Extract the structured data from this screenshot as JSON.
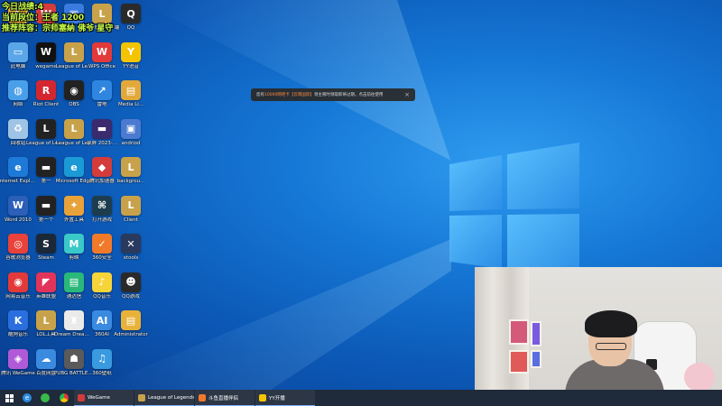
{
  "overlay": {
    "line1": "今日战绩:4",
    "line2": "当前段位：王者 1200",
    "line3": "推荐阵容：宗师塞納 佛爷 星守"
  },
  "notice": {
    "prefix": "您有",
    "highlight1": "10000网吧卡",
    "highlight2": "【云萌国际】",
    "suffix": "领主限时领取即将过期，点击前往使用",
    "close": "×"
  },
  "desktop_icons": [
    {
      "label": "",
      "color": "#e8b23a",
      "glyph": "L",
      "icon": "league-icon"
    },
    {
      "label": "",
      "color": "#d63b3b",
      "glyph": "W",
      "icon": "wegame-icon"
    },
    {
      "label": "",
      "color": "#3b7be0",
      "glyph": "▣",
      "icon": "app-icon"
    },
    {
      "label": "英雄联盟客户端",
      "color": "#c8a24a",
      "glyph": "L",
      "icon": "league-icon"
    },
    {
      "label": "QQ",
      "color": "#2a2a2a",
      "glyph": "Q",
      "icon": "qq-icon"
    },
    {
      "label": "此电脑",
      "color": "#5aa6e8",
      "glyph": "▭",
      "icon": "computer-icon"
    },
    {
      "label": "wegame",
      "color": "#111",
      "glyph": "W",
      "icon": "wegame-icon"
    },
    {
      "label": "League of Le...",
      "color": "#c8a24a",
      "glyph": "L",
      "icon": "league-icon"
    },
    {
      "label": "WPS Office",
      "color": "#e23a3a",
      "glyph": "W",
      "icon": "wps-icon"
    },
    {
      "label": "YY语音",
      "color": "#f5c400",
      "glyph": "Y",
      "icon": "yy-icon"
    },
    {
      "label": "网络",
      "color": "#4aa0e8",
      "glyph": "◍",
      "icon": "network-icon"
    },
    {
      "label": "Riot Client",
      "color": "#d4262f",
      "glyph": "R",
      "icon": "riot-icon"
    },
    {
      "label": "OBS",
      "color": "#222",
      "glyph": "◉",
      "icon": "obs-icon"
    },
    {
      "label": "雷电",
      "color": "#2f86e0",
      "glyph": "↗",
      "icon": "app-icon"
    },
    {
      "label": "Media Li...",
      "color": "#e2a93a",
      "glyph": "▤",
      "icon": "folder-icon"
    },
    {
      "label": "回收站",
      "color": "#9fc4e6",
      "glyph": "♻",
      "icon": "recycle-bin-icon"
    },
    {
      "label": "League of Legends",
      "color": "#222",
      "glyph": "L",
      "icon": "league-icon"
    },
    {
      "label": "League of Le...",
      "color": "#c8a24a",
      "glyph": "L",
      "icon": "league-icon"
    },
    {
      "label": "录屏 2023-...",
      "color": "#3a2a6e",
      "glyph": "▬",
      "icon": "video-icon"
    },
    {
      "label": "andriod",
      "color": "#4a7bd0",
      "glyph": "▣",
      "icon": "app-icon"
    },
    {
      "label": "Internet Explorer",
      "color": "#1e7ad8",
      "glyph": "e",
      "icon": "ie-icon"
    },
    {
      "label": "第一",
      "color": "#222",
      "glyph": "▬",
      "icon": "video-icon"
    },
    {
      "label": "Microsoft Edge",
      "color": "#1c9ad6",
      "glyph": "e",
      "icon": "edge-icon"
    },
    {
      "label": "腾讯加速器",
      "color": "#d43b3b",
      "glyph": "◆",
      "icon": "app-icon"
    },
    {
      "label": "backgrou...",
      "color": "#c8a24a",
      "glyph": "L",
      "icon": "league-icon"
    },
    {
      "label": "Word 2010",
      "color": "#2b5fb8",
      "glyph": "W",
      "icon": "word-icon"
    },
    {
      "label": "第一个",
      "color": "#222",
      "glyph": "▬",
      "icon": "video-icon"
    },
    {
      "label": "外置工具",
      "color": "#e8a23a",
      "glyph": "✦",
      "icon": "app-icon"
    },
    {
      "label": "打开游戏",
      "color": "#1d3d4e",
      "glyph": "⌘",
      "icon": "app-icon"
    },
    {
      "label": "Client",
      "color": "#c8a24a",
      "glyph": "L",
      "icon": "league-icon"
    },
    {
      "label": "谷歌浏览器",
      "color": "#e8423a",
      "glyph": "◎",
      "icon": "chrome-icon"
    },
    {
      "label": "Steam",
      "color": "#1b2838",
      "glyph": "S",
      "icon": "steam-icon"
    },
    {
      "label": "剪映",
      "color": "#3ac8c8",
      "glyph": "M",
      "icon": "app-icon"
    },
    {
      "label": "360安全",
      "color": "#f07a2a",
      "glyph": "✓",
      "icon": "app-icon"
    },
    {
      "label": "xtools",
      "color": "#2a3a5e",
      "glyph": "✕",
      "icon": "app-icon"
    },
    {
      "label": "网易云音乐",
      "color": "#e23a3a",
      "glyph": "◉",
      "icon": "netease-icon"
    },
    {
      "label": "英雄联盟",
      "color": "#e2345a",
      "glyph": "◤",
      "icon": "app-icon"
    },
    {
      "label": "通达信",
      "color": "#2ab87a",
      "glyph": "▤",
      "icon": "app-icon"
    },
    {
      "label": "QQ音乐",
      "color": "#f5d43a",
      "glyph": "♪",
      "icon": "app-icon"
    },
    {
      "label": "QQ游戏",
      "color": "#2a2a2a",
      "glyph": "☻",
      "icon": "app-icon"
    },
    {
      "label": "酷狗音乐",
      "color": "#2a6fe0",
      "glyph": "K",
      "icon": "kugou-icon"
    },
    {
      "label": "LOL工具",
      "color": "#c8a24a",
      "glyph": "L",
      "icon": "league-icon"
    },
    {
      "label": "Dream Dream Bo...",
      "color": "#eaeaea",
      "glyph": "♜",
      "icon": "app-icon"
    },
    {
      "label": "360AI",
      "color": "#3a8ae0",
      "glyph": "AI",
      "icon": "app-icon"
    },
    {
      "label": "Administrator",
      "color": "#e8b23a",
      "glyph": "▤",
      "icon": "folder-icon"
    },
    {
      "label": "腾讯 WeGame",
      "color": "#b05ad8",
      "glyph": "◈",
      "icon": "app-icon"
    },
    {
      "label": "百度网盘",
      "color": "#3a8ae0",
      "glyph": "☁",
      "icon": "cloud-icon"
    },
    {
      "label": "PUBG BATTLEGR...",
      "color": "#5a5a5a",
      "glyph": "☗",
      "icon": "app-icon"
    },
    {
      "label": "360壁纸",
      "color": "#3a9ae0",
      "glyph": "♫",
      "icon": "app-icon"
    }
  ],
  "taskbar": {
    "apps": [
      {
        "label": "WeGame",
        "color": "#d43b3b"
      },
      {
        "label": "League of Legends",
        "color": "#c8a24a"
      },
      {
        "label": "斗鱼直播伴侣",
        "color": "#f07a2a"
      },
      {
        "label": "YY开播",
        "color": "#f5c400"
      }
    ]
  },
  "colors": {
    "desktop_blue": "#1678d6",
    "overlay_text": "#c8ff4a",
    "taskbar": "#1f2a3a"
  }
}
